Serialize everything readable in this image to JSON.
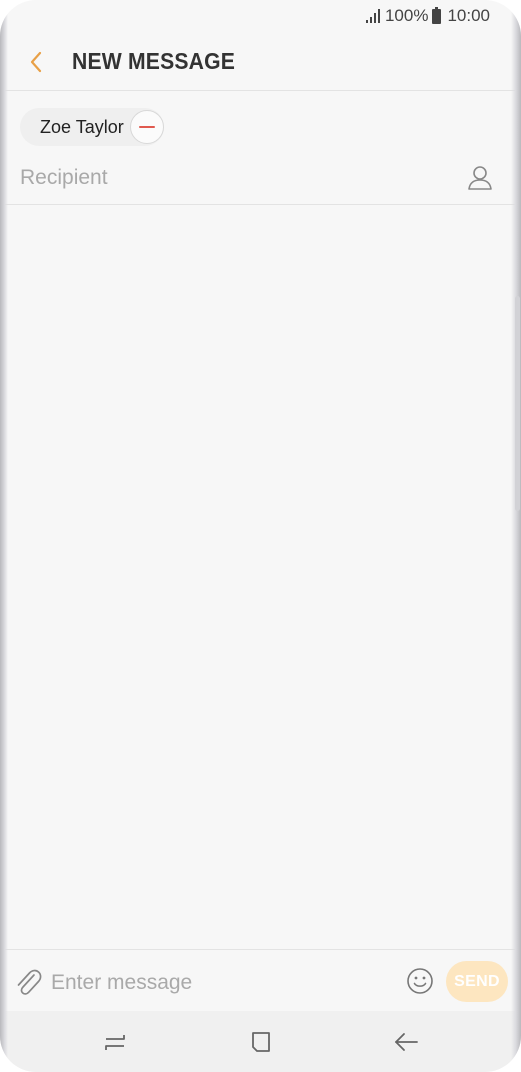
{
  "status_bar": {
    "battery": "100%",
    "time": "10:00",
    "icons": [
      "signal-icon",
      "battery-icon"
    ]
  },
  "header": {
    "back_icon": "chevron-left-icon",
    "title": "NEW MESSAGE"
  },
  "recipients": {
    "chips": [
      {
        "name": "Zoe Taylor",
        "remove_icon": "minus-circle-icon"
      }
    ],
    "input_placeholder": "Recipient",
    "input_value": "",
    "contact_icon": "contact-person-icon"
  },
  "composer": {
    "attach_icon": "paperclip-icon",
    "placeholder": "Enter message",
    "value": "",
    "emoji_icon": "smiley-icon",
    "send_label": "SEND"
  },
  "nav_bar": {
    "items": [
      "recent-apps-icon",
      "home-icon",
      "back-icon"
    ]
  },
  "colors": {
    "accent": "#e8a047",
    "send_disabled": "#fde6c0",
    "remove_red": "#e0594f",
    "background": "#f7f7f7"
  }
}
